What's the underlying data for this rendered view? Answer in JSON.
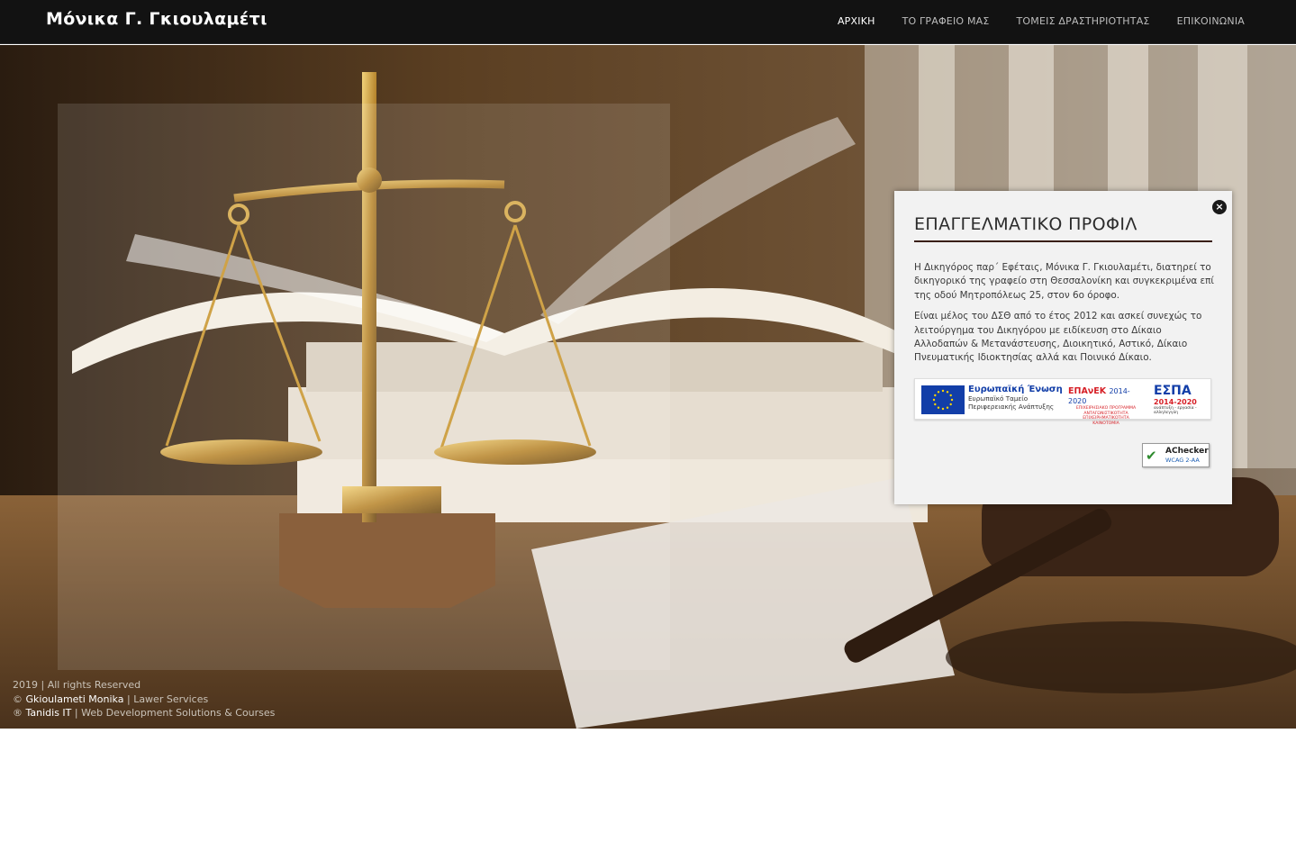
{
  "header": {
    "logo": "Μόνικα Γ. Γκιουλαμέτι",
    "nav": [
      {
        "label": "ΑΡΧΙΚΗ",
        "active": true
      },
      {
        "label": "ΤΟ ΓΡΑΦΕΙΟ ΜΑΣ",
        "active": false
      },
      {
        "label": "ΤΟΜΕΙΣ ΔΡΑΣΤΗΡΙΟΤΗΤΑΣ",
        "active": false
      },
      {
        "label": "ΕΠΙΚΟΙΝΩΝΙΑ",
        "active": false
      }
    ]
  },
  "panel": {
    "close_label": "×",
    "title": "ΕΠΑΓΓΕΛΜΑΤΙΚΟ ΠΡΟΦΙΛ",
    "paragraphs": [
      "Η Δικηγόρος παρ΄ Εφέταις, Μόνικα Γ. Γκιουλαμέτι, διατηρεί το δικηγορικό της γραφείο στη Θεσσαλονίκη και συγκεκριμένα επί της οδού Μητροπόλεως 25, στον 6ο όροφο.",
      "Είναι μέλος του ΔΣΘ από το έτος 2012 και ασκεί συνεχώς το λειτούργημα του Δικηγόρου με ειδίκευση στο Δίκαιο Αλλοδαπών & Μετανάστευσης, Διοικητικό, Αστικό, Δίκαιο Πνευματικής Ιδιοκτησίας αλλά και Ποινικό Δίκαιο."
    ],
    "espa": {
      "eu_title": "Ευρωπαϊκή Ένωση",
      "eu_line1": "Ευρωπαϊκό Ταμείο",
      "eu_line2": "Περιφερειακής Ανάπτυξης",
      "epanek_title": "ΕΠΑνΕΚ",
      "epanek_years": "2014-2020",
      "epanek_line1": "ΕΠΙΧΕΙΡΗΣΙΑΚΟ ΠΡΟΓΡΑΜΜΑ",
      "epanek_line2": "ΑΝΤΑΓΩΝΙΣΤΙΚΟΤΗΤΑ",
      "epanek_line3": "ΕΠΙΧΕΙΡΗΜΑΤΙΚΟΤΗΤΑ",
      "epanek_line4": "ΚΑΙΝΟΤΟΜΙΑ",
      "espa_title": "ΕΣΠΑ",
      "espa_years": "2014-2020",
      "espa_motto": "ανάπτυξη - εργασία - αλληλεγγύη"
    },
    "achecker": {
      "title": "AChecker",
      "subtitle": "WCAG 2-AA"
    }
  },
  "credits": {
    "line1": "2019 | All rights Reserved",
    "line2_prefix": "©",
    "line2_name": "Gkioulameti Monika",
    "line2_sep": "|",
    "line2_rest": "Lawer Services",
    "line3_prefix": "®",
    "line3_name": "Tanidis IT",
    "line3_sep": "|",
    "line3_rest": "Web Development Solutions & Courses"
  },
  "colors": {
    "header_bg": "#121212",
    "panel_bg": "#f2f2f2",
    "panel_rule": "#3a1f16"
  }
}
